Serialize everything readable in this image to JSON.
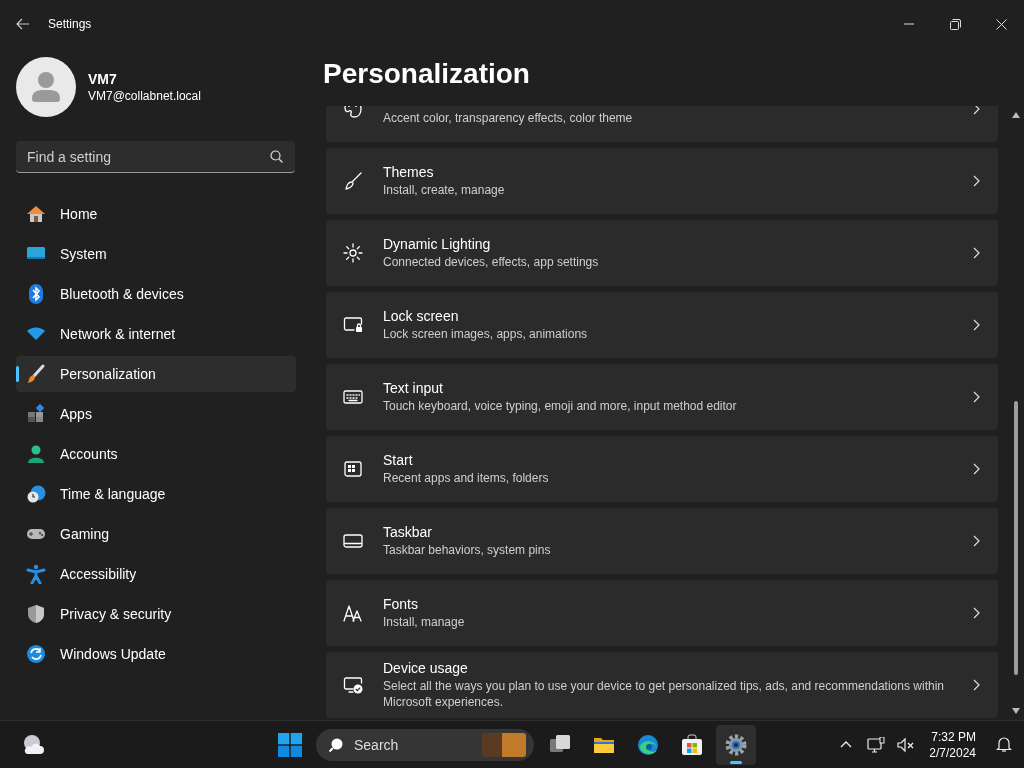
{
  "window": {
    "title": "Settings"
  },
  "profile": {
    "name": "VM7",
    "email": "VM7@collabnet.local"
  },
  "search": {
    "placeholder": "Find a setting"
  },
  "nav": [
    {
      "label": "Home",
      "selected": false
    },
    {
      "label": "System",
      "selected": false
    },
    {
      "label": "Bluetooth & devices",
      "selected": false
    },
    {
      "label": "Network & internet",
      "selected": false
    },
    {
      "label": "Personalization",
      "selected": true
    },
    {
      "label": "Apps",
      "selected": false
    },
    {
      "label": "Accounts",
      "selected": false
    },
    {
      "label": "Time & language",
      "selected": false
    },
    {
      "label": "Gaming",
      "selected": false
    },
    {
      "label": "Accessibility",
      "selected": false
    },
    {
      "label": "Privacy & security",
      "selected": false
    },
    {
      "label": "Windows Update",
      "selected": false
    }
  ],
  "page": {
    "title": "Personalization"
  },
  "cards": [
    {
      "subtitle": "Accent color, transparency effects, color theme"
    },
    {
      "title": "Themes",
      "subtitle": "Install, create, manage"
    },
    {
      "title": "Dynamic Lighting",
      "subtitle": "Connected devices, effects, app settings"
    },
    {
      "title": "Lock screen",
      "subtitle": "Lock screen images, apps, animations"
    },
    {
      "title": "Text input",
      "subtitle": "Touch keyboard, voice typing, emoji and more, input method editor"
    },
    {
      "title": "Start",
      "subtitle": "Recent apps and items, folders"
    },
    {
      "title": "Taskbar",
      "subtitle": "Taskbar behaviors, system pins"
    },
    {
      "title": "Fonts",
      "subtitle": "Install, manage"
    },
    {
      "title": "Device usage",
      "subtitle": "Select all the ways you plan to use your device to get personalized tips, ads, and recommendations within Microsoft experiences."
    }
  ],
  "taskbar": {
    "search": {
      "placeholder": "Search"
    },
    "apps": [
      {
        "selected": false
      },
      {
        "selected": false
      },
      {
        "selected": false
      },
      {
        "selected": false
      },
      {
        "selected": true
      }
    ],
    "clock": {
      "time": "7:32 PM",
      "date": "2/7/2024"
    }
  }
}
